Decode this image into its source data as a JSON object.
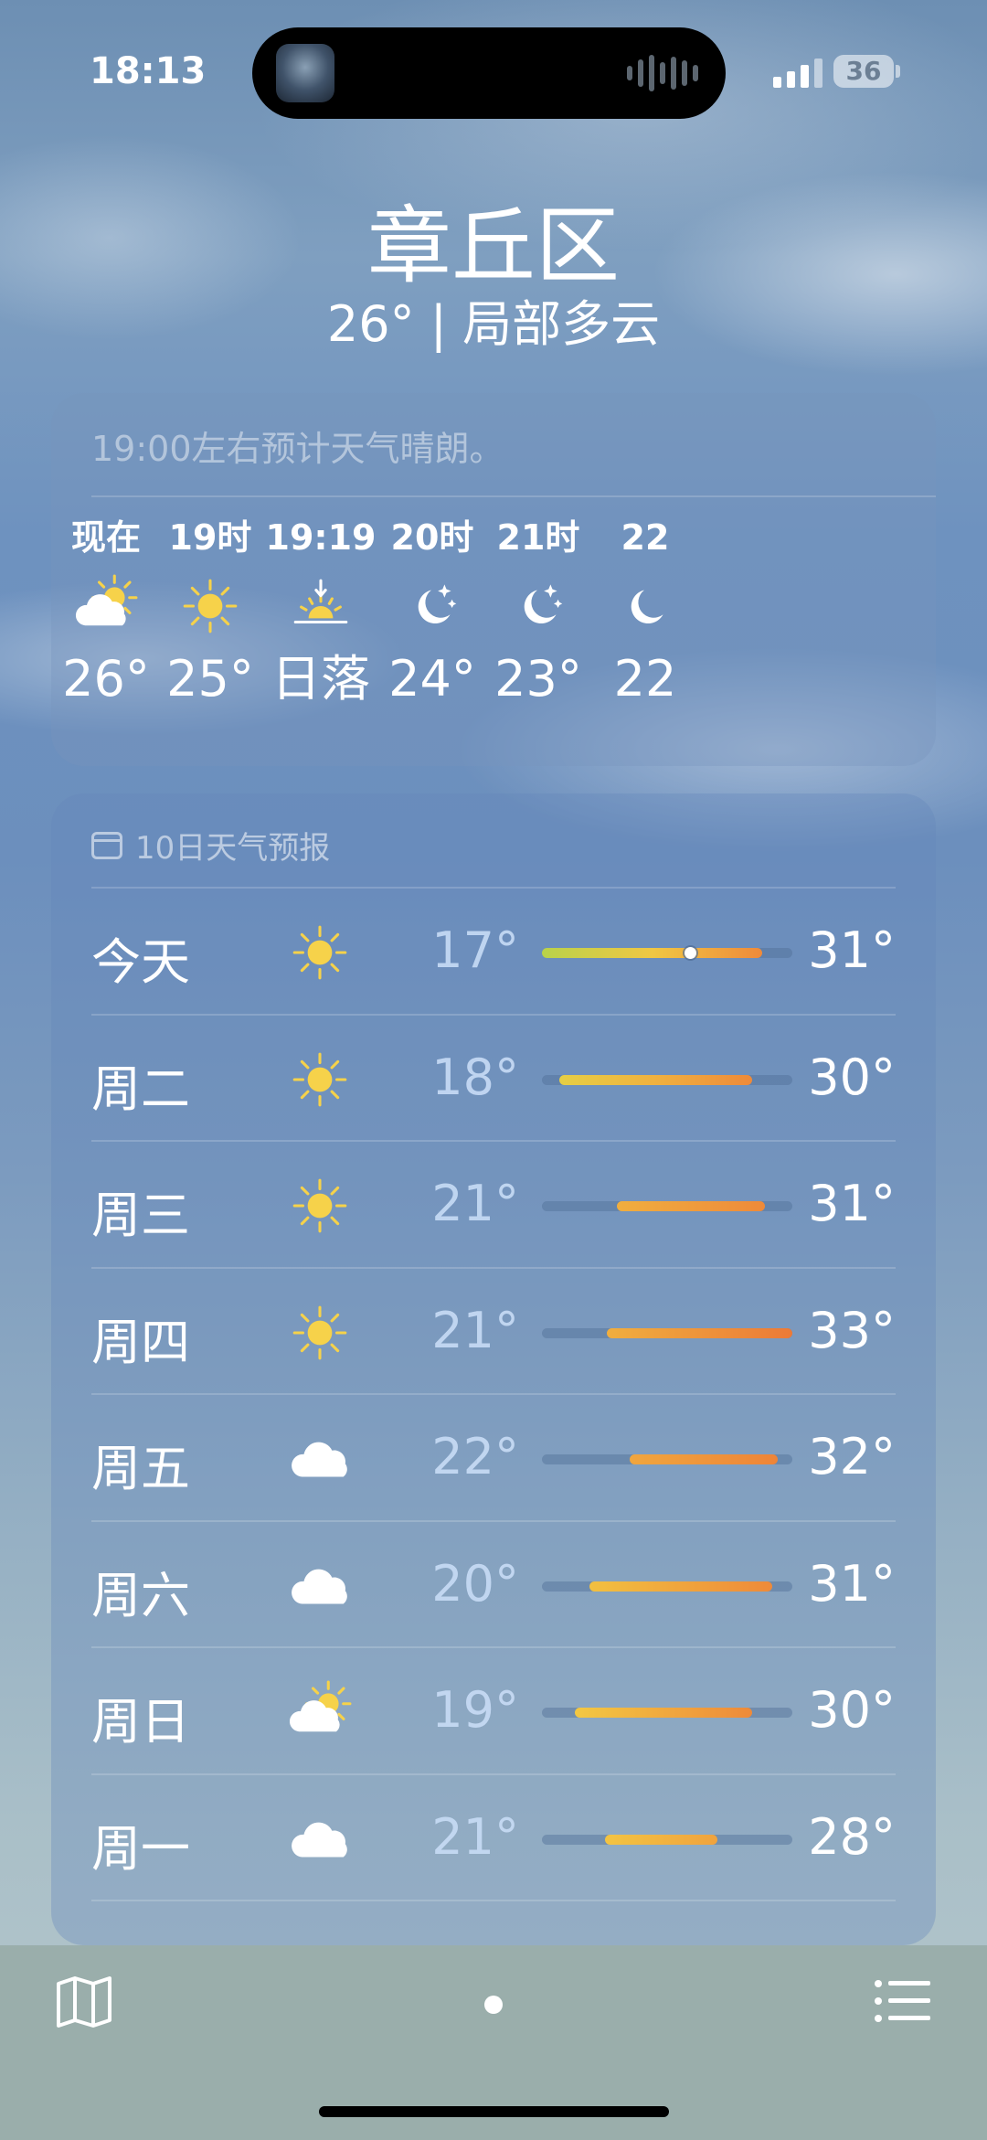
{
  "status": {
    "time": "18:13",
    "battery": "36"
  },
  "header": {
    "city": "章丘区",
    "summary": "26° | 局部多云"
  },
  "hourly": {
    "note": "19:00左右预计天气晴朗。",
    "items": [
      {
        "label": "现在",
        "icon": "partly-sunny-icon",
        "temp": "26°"
      },
      {
        "label": "19时",
        "icon": "sun-icon",
        "temp": "25°"
      },
      {
        "label": "19:19",
        "icon": "sunset-icon",
        "temp": "日落"
      },
      {
        "label": "20时",
        "icon": "moon-stars-icon",
        "temp": "24°"
      },
      {
        "label": "21时",
        "icon": "moon-stars-icon",
        "temp": "23°"
      },
      {
        "label": "22",
        "icon": "moon-icon",
        "temp": "22"
      }
    ]
  },
  "daily": {
    "title": "10日天气预报",
    "days": [
      {
        "name": "今天",
        "icon": "sun-icon",
        "low": "17°",
        "high": "31°",
        "range_start": 0.0,
        "range_end": 0.88,
        "current": 0.59,
        "gradient": [
          "#b9d24a",
          "#f0c743",
          "#ef8a3a"
        ]
      },
      {
        "name": "周二",
        "icon": "sun-icon",
        "low": "18°",
        "high": "30°",
        "range_start": 0.07,
        "range_end": 0.84,
        "gradient": [
          "#e6cf45",
          "#f0b13f",
          "#ee8a3a"
        ]
      },
      {
        "name": "周三",
        "icon": "sun-icon",
        "low": "21°",
        "high": "31°",
        "range_start": 0.3,
        "range_end": 0.89,
        "gradient": [
          "#f0ae3f",
          "#ee8a3a"
        ]
      },
      {
        "name": "周四",
        "icon": "sun-icon",
        "low": "21°",
        "high": "33°",
        "range_start": 0.26,
        "range_end": 1.0,
        "gradient": [
          "#f0ae3f",
          "#ec7a37"
        ]
      },
      {
        "name": "周五",
        "icon": "cloud-icon",
        "low": "22°",
        "high": "32°",
        "range_start": 0.35,
        "range_end": 0.94,
        "gradient": [
          "#f0a63e",
          "#ee8438"
        ]
      },
      {
        "name": "周六",
        "icon": "cloud-icon",
        "low": "20°",
        "high": "31°",
        "range_start": 0.19,
        "range_end": 0.92,
        "gradient": [
          "#f2c040",
          "#ee8a3a"
        ]
      },
      {
        "name": "周日",
        "icon": "partly-sunny-icon",
        "low": "19°",
        "high": "30°",
        "range_start": 0.13,
        "range_end": 0.84,
        "gradient": [
          "#f3c842",
          "#ee8a3a"
        ]
      },
      {
        "name": "周一",
        "icon": "cloud-icon",
        "low": "21°",
        "high": "28°",
        "range_start": 0.25,
        "range_end": 0.7,
        "gradient": [
          "#f3c442",
          "#f0a33e"
        ]
      }
    ]
  }
}
